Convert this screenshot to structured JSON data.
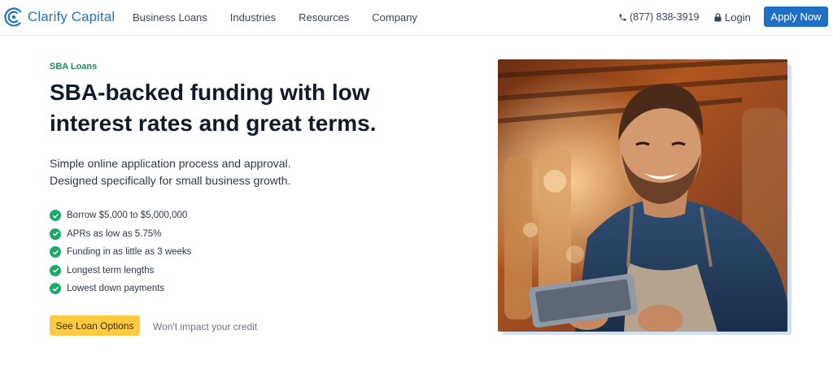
{
  "brand": {
    "name": "Clarify Capital",
    "color": "#1d74c4"
  },
  "nav": {
    "items": [
      "Business Loans",
      "Industries",
      "Resources",
      "Company"
    ],
    "phone": "(877) 838-3919",
    "login": "Login",
    "apply": "Apply Now"
  },
  "hero": {
    "eyebrow": "SBA Loans",
    "headline": "SBA-backed funding with low interest rates and great terms.",
    "subtext_line1": "Simple online application process and approval.",
    "subtext_line2": "Designed specifically for small business growth.",
    "benefits": [
      "Borrow $5,000 to $5,000,000",
      "APRs as low as 5.75%",
      "Funding in as little as 3 weeks",
      "Longest term lengths",
      "Lowest down payments"
    ],
    "cta": "See Loan Options",
    "cta_note": "Won't impact your credit"
  },
  "colors": {
    "accent": "#1f6fc5",
    "eyebrow": "#1c8a5c",
    "check": "#1ca86a",
    "cta": "#ffc940"
  },
  "icons": {
    "phone": "phone-icon",
    "login": "lock-icon",
    "benefit": "check-circle-icon"
  }
}
